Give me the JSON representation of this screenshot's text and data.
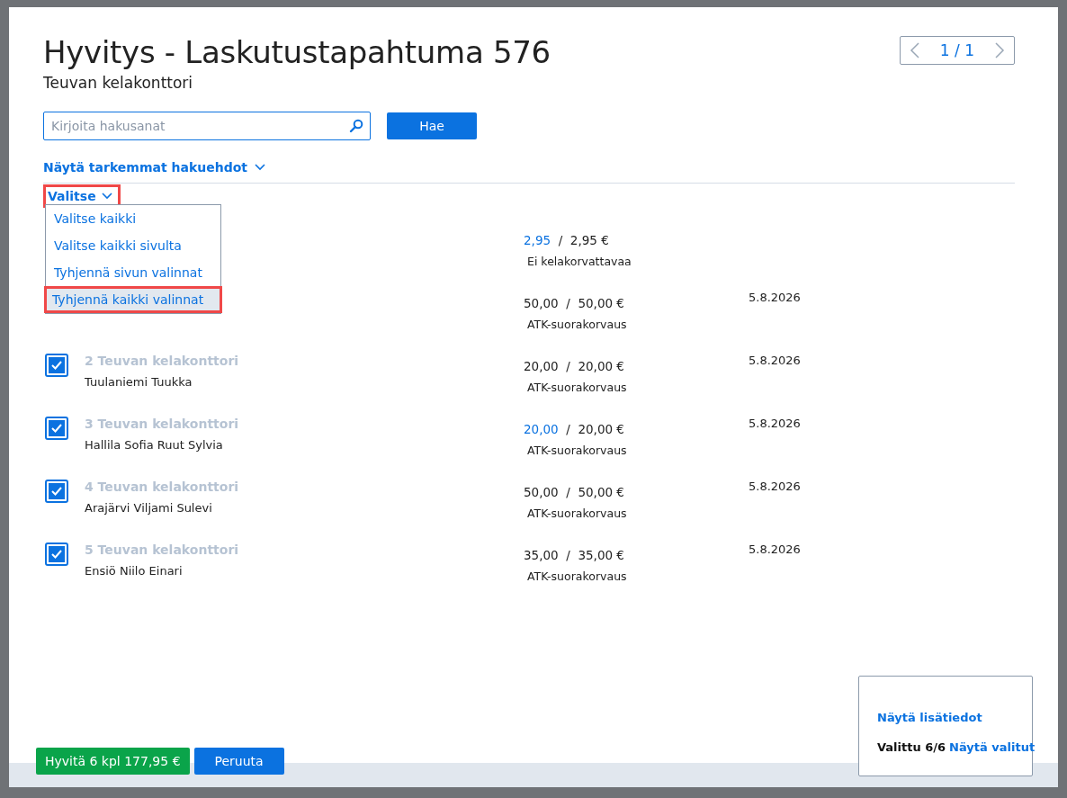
{
  "dialog": {
    "title": "Hyvitys - Laskutustapahtuma 576",
    "subtitle": "Teuvan kelakonttori",
    "pager": "1 / 1"
  },
  "search": {
    "placeholder": "Kirjoita hakusanat",
    "button": "Hae"
  },
  "advanced_link": "Näytä tarkemmat hakuehdot",
  "select_menu": {
    "label": "Valitse",
    "highlighted": true,
    "expanded": true,
    "items": [
      {
        "label": "Valitse kaikki",
        "selected": false
      },
      {
        "label": "Valitse kaikki sivulta",
        "selected": false
      },
      {
        "label": "Tyhjennä sivun valinnat",
        "selected": false
      },
      {
        "label": "Tyhjennä kaikki valinnat",
        "selected": true
      }
    ]
  },
  "rows": [
    {
      "amount": "2,95",
      "amount_edited": true,
      "separator": "/",
      "total": "2,95 €",
      "type": "Ei kelakorvattavaa"
    },
    {
      "amount": "50,00",
      "amount_edited": false,
      "separator": "/",
      "total": "50,00 €",
      "type": "ATK-suorakorvaus",
      "date": "5.8.2026"
    },
    {
      "checked": true,
      "title": "2 Teuvan kelakonttori",
      "name": "Tuulaniemi Tuukka",
      "amount": "20,00",
      "amount_edited": false,
      "separator": "/",
      "total": "20,00 €",
      "type": "ATK-suorakorvaus",
      "date": "5.8.2026"
    },
    {
      "checked": true,
      "title": "3 Teuvan kelakonttori",
      "name": "Hallila Sofia Ruut Sylvia",
      "amount": "20,00",
      "amount_edited": true,
      "separator": "/",
      "total": "20,00 €",
      "type": "ATK-suorakorvaus",
      "date": "5.8.2026"
    },
    {
      "checked": true,
      "title": "4 Teuvan kelakonttori",
      "name": "Arajärvi Viljami Sulevi",
      "amount": "50,00",
      "amount_edited": false,
      "separator": "/",
      "total": "50,00 €",
      "type": "ATK-suorakorvaus",
      "date": "5.8.2026"
    },
    {
      "checked": true,
      "title": "5 Teuvan kelakonttori",
      "name": "Ensiö Niilo Einari",
      "amount": "35,00",
      "amount_edited": false,
      "separator": "/",
      "total": "35,00 €",
      "type": "ATK-suorakorvaus",
      "date": "5.8.2026"
    }
  ],
  "info_panel": {
    "details_link": "Näytä lisätiedot",
    "selected_count": "Valittu 6/6",
    "show_selected_link": "Näytä valitut"
  },
  "footer": {
    "confirm": "Hyvitä 6 kpl 177,95 €",
    "cancel": "Peruuta"
  }
}
